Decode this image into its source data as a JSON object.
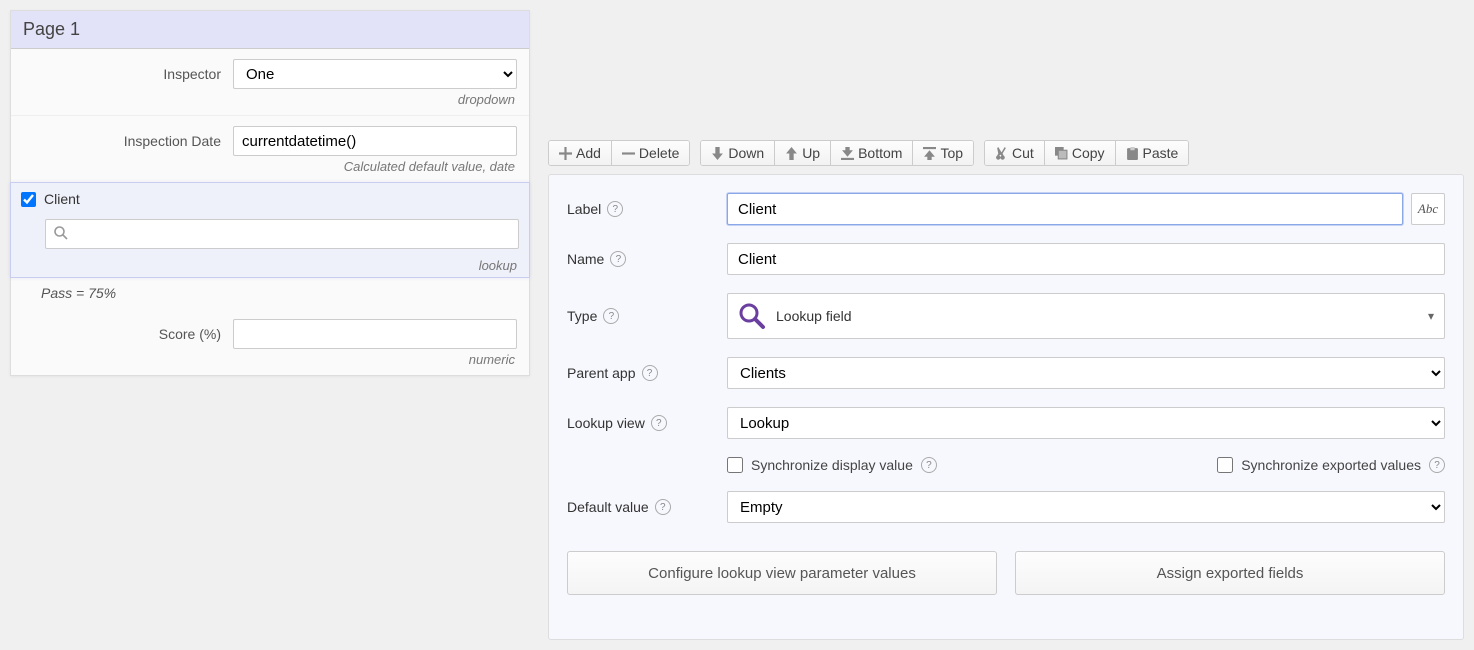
{
  "left": {
    "page_title": "Page 1",
    "fields": {
      "inspector": {
        "label": "Inspector",
        "value": "One",
        "hint": "dropdown"
      },
      "inspection_date": {
        "label": "Inspection Date",
        "value": "currentdatetime()",
        "hint": "Calculated default value, date"
      },
      "client": {
        "label": "Client",
        "checked": true,
        "value": "",
        "hint": "lookup"
      },
      "pass_text": "Pass = 75%",
      "score": {
        "label": "Score (%)",
        "value": "",
        "hint": "numeric"
      }
    }
  },
  "toolbar": {
    "add": "Add",
    "delete": "Delete",
    "down": "Down",
    "up": "Up",
    "bottom": "Bottom",
    "top": "Top",
    "cut": "Cut",
    "copy": "Copy",
    "paste": "Paste"
  },
  "props": {
    "label": {
      "caption": "Label",
      "value": "Client"
    },
    "name": {
      "caption": "Name",
      "value": "Client"
    },
    "type": {
      "caption": "Type",
      "value": "Lookup field"
    },
    "parent_app": {
      "caption": "Parent app",
      "value": "Clients"
    },
    "lookup_view": {
      "caption": "Lookup view",
      "value": "Lookup"
    },
    "sync_display": "Synchronize display value",
    "sync_export": "Synchronize exported values",
    "default_value": {
      "caption": "Default value",
      "value": "Empty"
    },
    "config_btn": "Configure lookup view parameter values",
    "assign_btn": "Assign exported fields"
  }
}
